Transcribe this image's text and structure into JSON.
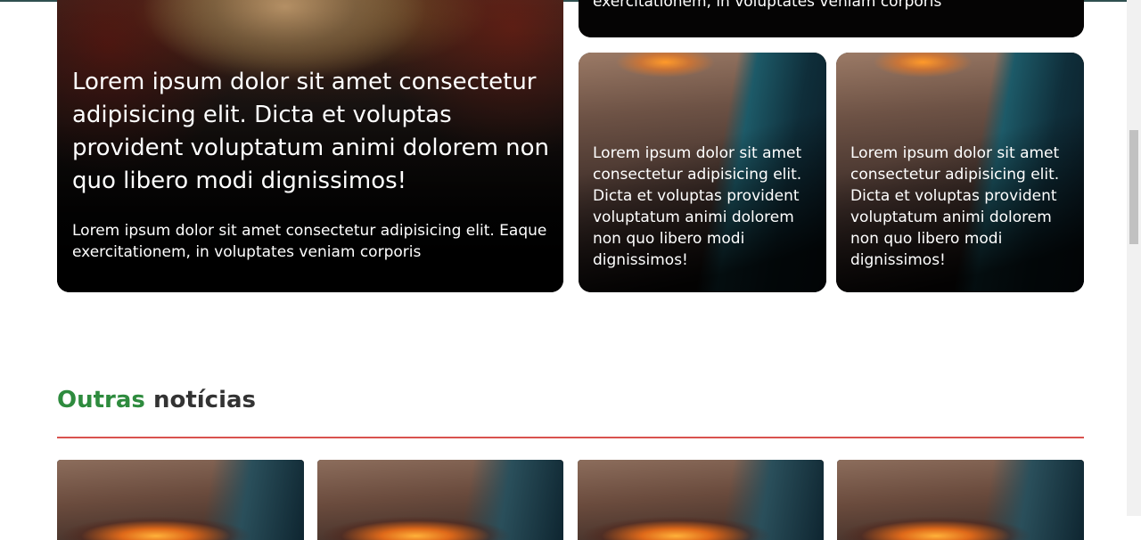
{
  "featured": {
    "main": {
      "title": "Lorem ipsum dolor sit amet consectetur adipisicing elit. Dicta et voluptas provident voluptatum animi dolorem non quo libero modi dignissimos!",
      "text": "Lorem ipsum dolor sit amet consectetur adipisicing elit. Eaque exercitationem, in voluptates veniam corporis"
    },
    "top_right_partial_text": "exercitationem, in voluptates veniam corporis",
    "small_cards": [
      {
        "title": "Lorem ipsum dolor sit amet consectetur adipisicing elit. Dicta et voluptas provident voluptatum animi dolorem non quo libero modi dignissimos!"
      },
      {
        "title": "Lorem ipsum dolor sit amet consectetur adipisicing elit. Dicta et voluptas provident voluptatum animi dolorem non quo libero modi dignissimos!"
      }
    ]
  },
  "other_news": {
    "heading_accent": "Outras",
    "heading_rest": "notícias",
    "accent_color": "#2e8b3e",
    "divider_color": "#d9534f",
    "card_count": 4
  }
}
